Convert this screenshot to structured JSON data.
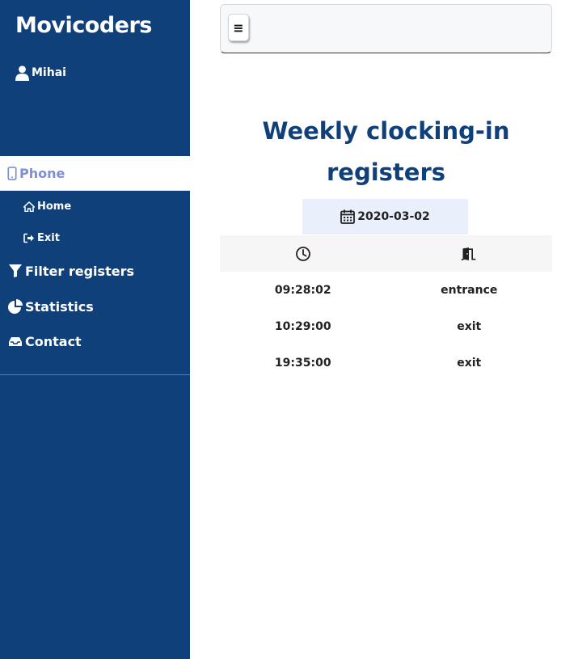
{
  "sidebar": {
    "brand": "Movicoders",
    "user": {
      "name": "Mihai",
      "icon": "user-icon"
    },
    "active_item": {
      "label": "Phone",
      "icon": "mobile-icon",
      "color": "#7f8fd3"
    },
    "sub_items": [
      {
        "label": "Home",
        "icon": "home-icon"
      },
      {
        "label": "Exit",
        "icon": "sign-out-icon"
      }
    ],
    "items": [
      {
        "label": "Filter registers",
        "icon": "filter-icon"
      },
      {
        "label": "Statistics",
        "icon": "chart-pie-icon"
      },
      {
        "label": "Contact",
        "icon": "inbox-icon"
      }
    ],
    "background": "#10407a"
  },
  "topbar": {
    "menu_button": "≡",
    "menu_icon": "hamburger-icon"
  },
  "main": {
    "title": "Weekly clocking-in registers",
    "title_color": "#10407a",
    "date": "2020-03-02",
    "date_icon": "calendar-icon",
    "table": {
      "header_icons": [
        "clock-icon",
        "door-open-icon"
      ],
      "rows": [
        {
          "time": "09:28:02",
          "type": "entrance"
        },
        {
          "time": "10:29:00",
          "type": "exit"
        },
        {
          "time": "19:35:00",
          "type": "exit"
        }
      ]
    }
  }
}
